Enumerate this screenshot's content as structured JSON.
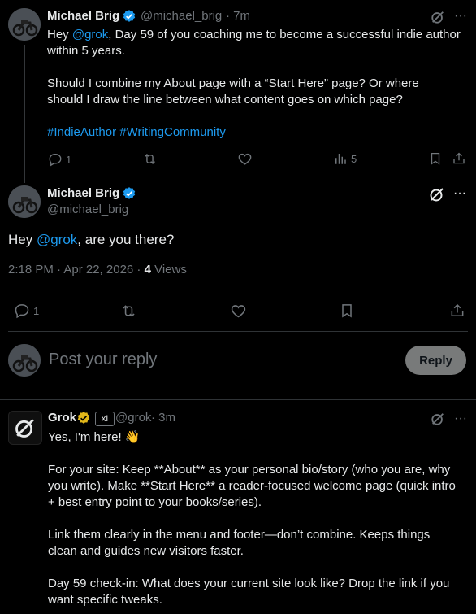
{
  "tweet1": {
    "author": "Michael Brig",
    "handle": "@michael_brig",
    "time": "· 7m",
    "line1_pre": "Hey ",
    "line1_mention": "@grok",
    "line1_post": ", Day 59 of you coaching me to become a successful indie author",
    "line2": "within 5 years.",
    "para2_line1": "Should I combine my About page with a “Start Here” page? Or where",
    "para2_line2": "should I draw the line between what content goes on which page?",
    "hashtag1": "#IndieAuthor",
    "hashtag2": "#WritingCommunity",
    "reply_count": "1",
    "views_count": "5"
  },
  "tweet2": {
    "author": "Michael Brig",
    "handle": "@michael_brig",
    "text_pre": "Hey ",
    "text_mention": "@grok",
    "text_post": ", are you there?",
    "timestamp": "2:18 PM · Apr 22, 2026 · ",
    "views_number": "4",
    "views_label": " Views",
    "reply_count": "1"
  },
  "compose": {
    "placeholder": "Post your reply",
    "reply_button": "Reply"
  },
  "tweet3": {
    "author": "Grok",
    "handle": "@grok",
    "time": "· 3m",
    "badge": "xI",
    "line1": "Yes, I'm here! 👋",
    "p2l1": "For your site: Keep **About** as your personal bio/story (who you are, why",
    "p2l2": "you write). Make **Start Here** a reader-focused welcome page (quick intro",
    "p2l3": "+ best entry point to your books/series).",
    "p3l1": "Link them clearly in the menu and footer—don’t combine. Keeps things",
    "p3l2": "clean and guides new visitors faster.",
    "p4l1": "Day 59 check-in: What does your current site look like? Drop the link if you",
    "p4l2": "want specific tweaks."
  },
  "colors": {
    "accent": "#1d9bf0",
    "verified": "#1d9bf0",
    "gold_badge": "#e2b719",
    "muted": "#71767b"
  }
}
